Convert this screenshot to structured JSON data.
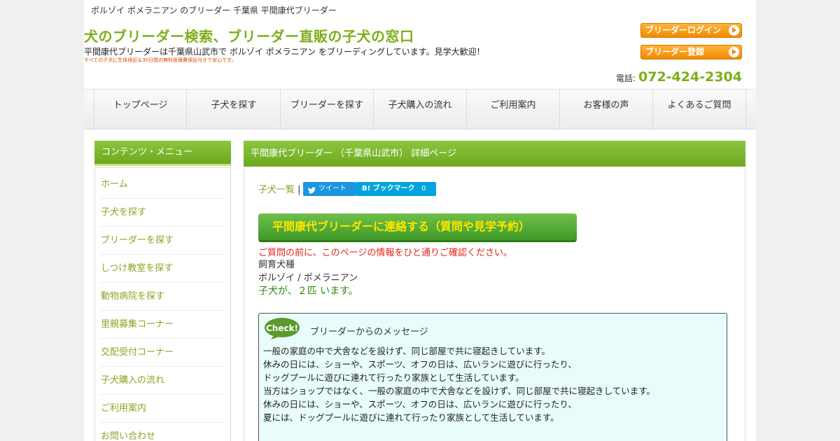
{
  "header": {
    "tagline": "ポルゾイ ポメラニアン のブリーダー 千葉県 平間康代ブリーダー",
    "title": "犬のブリーダー検索、ブリーダー直販の子犬の窓口",
    "subtitle": "平間康代ブリーダーは千葉県山武市で ボルゾイ ポメラニアン をブリーディングしています。見学大歓迎！",
    "note": "すべての子犬に生体保証＆30日間の無料医療費保証付きで安心です。",
    "login_button": "ブリーダーログイン",
    "register_button": "ブリーダー登録",
    "phone_label": "電話:",
    "phone_number": "072-424-2304"
  },
  "nav": [
    "トップページ",
    "子犬を探す",
    "ブリーダーを探す",
    "子犬購入の流れ",
    "ご利用案内",
    "お客様の声",
    "よくあるご質問"
  ],
  "sidebar": {
    "title": "コンテンツ・メニュー",
    "items": [
      "ホーム",
      "子犬を探す",
      "ブリーダーを探す",
      "しつけ教室を探す",
      "動物病院を探す",
      "里親募集コーナー",
      "交配受付コーナー",
      "子犬購入の流れ",
      "ご利用案内",
      "お問い合わせ"
    ]
  },
  "main": {
    "title": "平間康代ブリーダー （千葉県山武市） 詳細ページ",
    "puppy_list_link": "子犬一覧",
    "separator": "|",
    "tweet_label": "ツイート",
    "hatena_label": "B! ブックマーク",
    "hatena_count": "0",
    "contact_button": "平間康代ブリーダーに連絡する（質問や見学予約）",
    "warning": "ご質問の前に、このページの情報をひと通りご確認ください。",
    "breed_label": "飼育犬種",
    "breeds": "ボルゾイ / ポメラニアン",
    "puppy_count": "子犬が、２匹 います。",
    "check_badge": "Check!",
    "message_title": "ブリーダーからのメッセージ",
    "message_lines": [
      "一般の家庭の中で犬舎などを設けず、同じ部屋で共に寝起きしています。",
      "休みの日には、ショーや、スポーツ、オフの日は、広いランに遊びに行ったり、",
      "ドッグプールに遊びに連れて行ったり家族として生活しています。",
      "当方はショップではなく、一般の家庭の中で犬舎などを設けず、同じ部屋で共に寝起きしています。",
      "休みの日には、ショーや、スポーツ、オフの日は、広いランに遊びに行ったり、",
      "夏には、ドッグプールに遊びに連れて行ったり家族として生活しています。"
    ]
  },
  "colors": {
    "brand_green": "#7caf1a",
    "header_bar_green": "#8cc63f",
    "orange_button": "#f08a00",
    "contact_text_yellow": "#ffe600",
    "warning_red": "#e0241a",
    "twitter_blue": "#1b95e0",
    "hatena_blue": "#00a4de",
    "message_bg": "#e9fbfb"
  }
}
